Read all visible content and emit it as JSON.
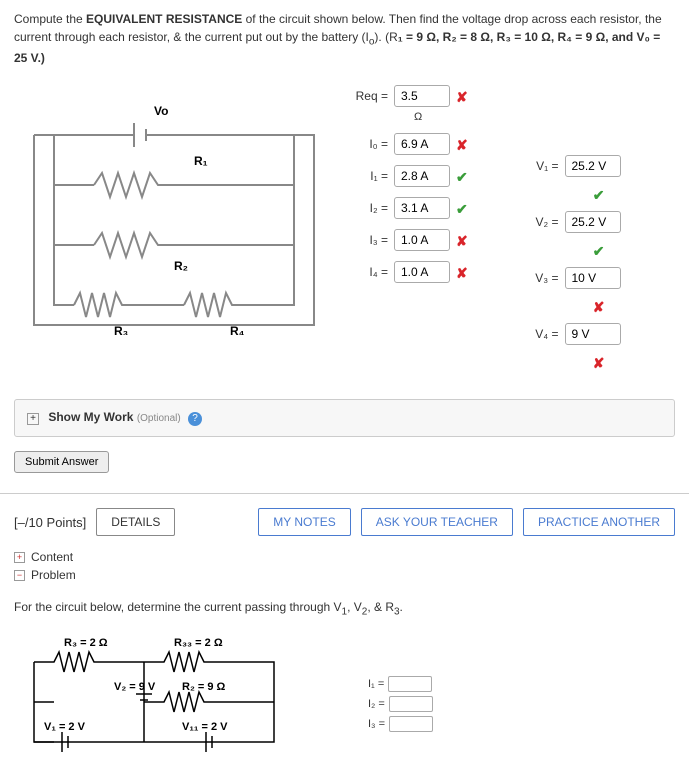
{
  "q1": {
    "prompt_1": "Compute the ",
    "prompt_bold": "EQUIVALENT RESISTANCE",
    "prompt_2": " of the circuit shown below. Then find the voltage drop across each resistor, the current through each resistor, & the current put out by the battery (I",
    "prompt_3": "). (R",
    "params": "₁ = 9 Ω, R₂ = 8 Ω, R₃ = 10 Ω, R₄ = 9 Ω, and V₀ = 25 V.)",
    "labels": {
      "Vo": "Vo",
      "R1": "R₁",
      "R2": "R₂",
      "R3": "R₃",
      "R4": "R₄"
    },
    "answers": {
      "Req": {
        "label": "Req =",
        "val": "3.5",
        "unit": "Ω",
        "mark": "x"
      },
      "Io": {
        "label": "I₀ =",
        "val": "6.9 A",
        "mark": "x"
      },
      "I1": {
        "label": "I₁ =",
        "val": "2.8 A",
        "mark": "v"
      },
      "I2": {
        "label": "I₂ =",
        "val": "3.1 A",
        "mark": "v"
      },
      "I3": {
        "label": "I₃ =",
        "val": "1.0 A",
        "mark": "x"
      },
      "I4": {
        "label": "I₄ =",
        "val": "1.0 A",
        "mark": "x"
      },
      "V1": {
        "label": "V₁ =",
        "val": "25.2 V",
        "mark": "v"
      },
      "V2": {
        "label": "V₂ =",
        "val": "25.2 V",
        "mark": "v"
      },
      "V3": {
        "label": "V₃ =",
        "val": "10 V",
        "mark": "x"
      },
      "V4": {
        "label": "V₄ =",
        "val": "9 V",
        "mark": "x"
      }
    }
  },
  "show_work": {
    "label": "Show My Work",
    "opt": "(Optional)"
  },
  "submit": "Submit Answer",
  "toolbar": {
    "points": "[–/10 Points]",
    "details": "DETAILS",
    "notes": "MY NOTES",
    "ask": "ASK YOUR TEACHER",
    "practice": "PRACTICE ANOTHER"
  },
  "accordion": {
    "content": "Content",
    "problem": "Problem"
  },
  "q2": {
    "prompt_a": "For the circuit below, determine the current passing through V",
    "prompt_b": ", V",
    "prompt_c": ", & R",
    "labels": {
      "R3": "R₃ = 2 Ω",
      "R33": "R₃₃ = 2 Ω",
      "V2": "V₂ = 9 V",
      "R2": "R₂ = 9 Ω",
      "V1": "V₁ = 2 V",
      "V11": "V₁₁ = 2 V"
    },
    "inputs": {
      "I1": "I₁ =",
      "I2": "I₂ =",
      "I3": "I₃ ="
    }
  }
}
